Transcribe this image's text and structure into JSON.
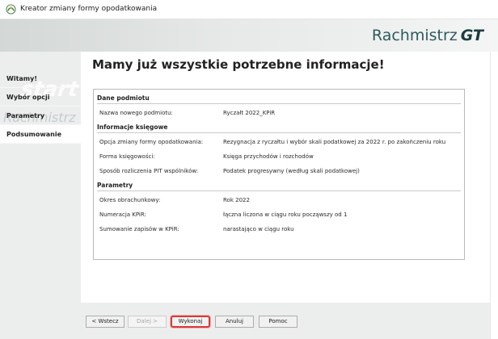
{
  "window": {
    "title": "Kreator zmiany formy opodatkowania"
  },
  "brand": {
    "name": "Rachmistrz",
    "logo": "GT",
    "color": "#2e5b5e"
  },
  "sidebar": {
    "items": [
      {
        "label": "Witamy!"
      },
      {
        "label": "Wybór opcji"
      },
      {
        "label": "Parametry"
      },
      {
        "label": "Podsumowanie"
      }
    ]
  },
  "main": {
    "heading": "Mamy już wszystkie potrzebne informacje!",
    "sections": [
      {
        "title": "Dane podmiotu",
        "rows": [
          {
            "label": "Nazwa nowego podmiotu:",
            "value": "Ryczałt 2022_KPiR"
          }
        ]
      },
      {
        "title": "Informacje księgowe",
        "rows": [
          {
            "label": "Opcja zmiany formy opodatkowania:",
            "value": "Rezygnacja z ryczałtu i wybór skali podatkowej za 2022 r. po zakończeniu roku"
          },
          {
            "label": "Forma księgowości:",
            "value": "Księga przychodów i rozchodów"
          },
          {
            "label": "Sposób rozliczenia PIT wspólników:",
            "value": "Podatek progresywny (według skali podatkowej)"
          }
        ]
      },
      {
        "title": "Parametry",
        "rows": [
          {
            "label": "Okres obrachunkowy:",
            "value": "Rok 2022"
          },
          {
            "label": "Numeracja KPiR:",
            "value": "łączna liczona w ciągu roku począwszy od 1"
          },
          {
            "label": "Sumowanie zapisów w KPiR:",
            "value": "narastająco w ciągu roku"
          }
        ]
      }
    ]
  },
  "footer": {
    "back": "< Wstecz",
    "next": "Dalej >",
    "execute": "Wykonaj",
    "cancel": "Anuluj",
    "help": "Pomoc"
  },
  "colors": {
    "highlight": "#d63a3a"
  }
}
